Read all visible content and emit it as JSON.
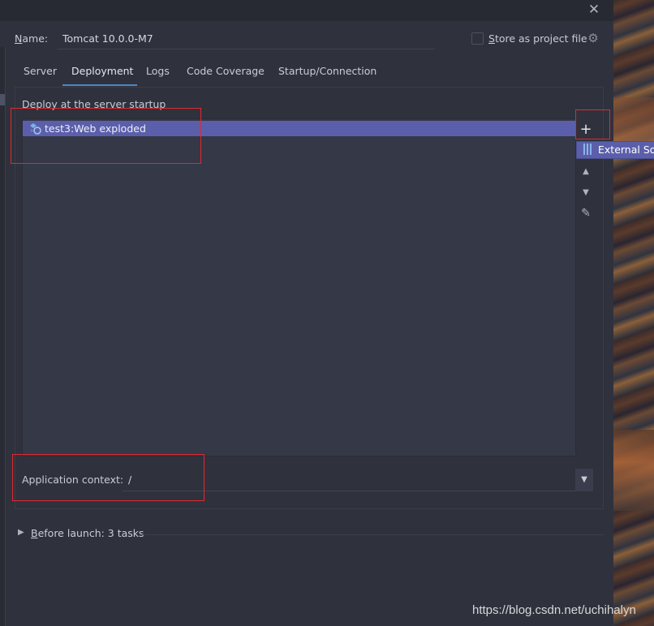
{
  "dialog": {
    "name_label": "Name:",
    "name_value": "Tomcat 10.0.0-M7",
    "store_label": "Store as project file",
    "icons": {
      "close": "close-icon",
      "settings": "gear-icon"
    }
  },
  "tabs": [
    {
      "label": "Server",
      "active": false
    },
    {
      "label": "Deployment",
      "active": true
    },
    {
      "label": "Logs",
      "active": false
    },
    {
      "label": "Code Coverage",
      "active": false
    },
    {
      "label": "Startup/Connection",
      "active": false
    }
  ],
  "deployment": {
    "section_label": "Deploy at the server startup",
    "items": [
      {
        "label": "test3:Web exploded",
        "selected": true
      }
    ],
    "toolbar": {
      "add": "+",
      "move_up": "▲",
      "move_down": "▼",
      "edit": "✎"
    },
    "popup_item": "External Sou"
  },
  "app_context": {
    "label": "Application context:",
    "value": "/"
  },
  "before_launch": {
    "label": "Before launch: 3 tasks"
  },
  "watermark": "https://blog.csdn.net/uchihalyn",
  "colors": {
    "accent": "#4a88c7",
    "selection": "#5b5fab",
    "annotation": "#e0292f"
  }
}
